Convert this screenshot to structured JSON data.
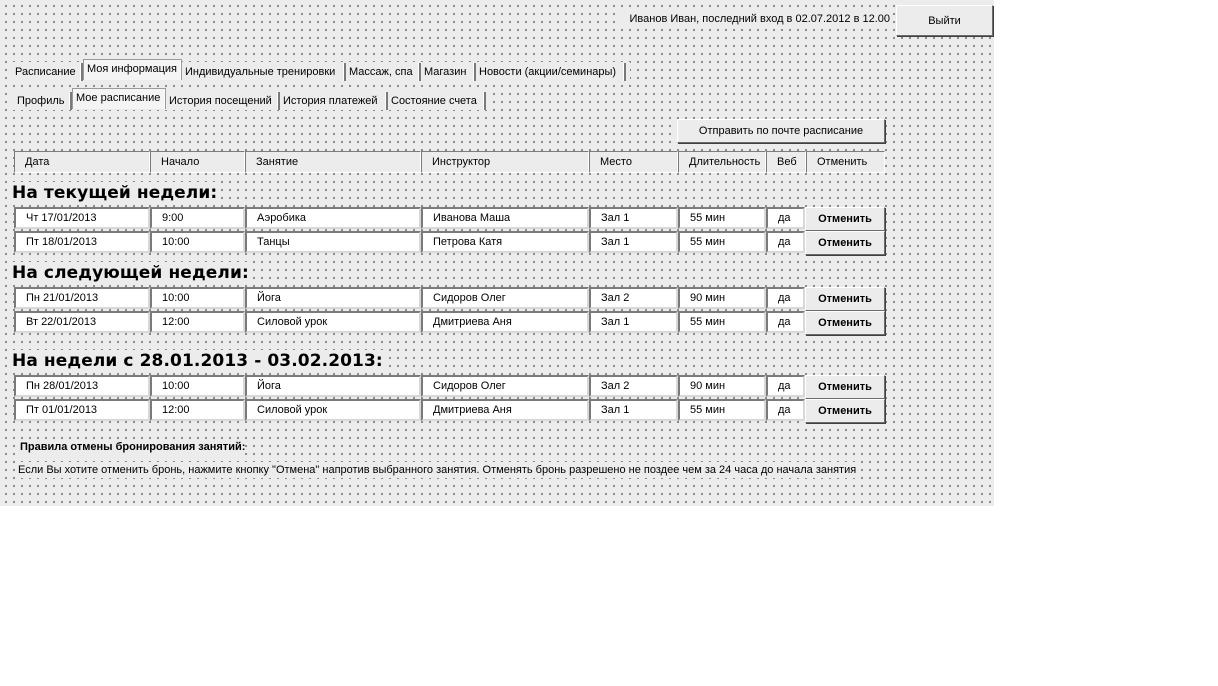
{
  "header": {
    "user_info": "Иванов Иван, последний вход в 02.07.2012 в 12.00",
    "logout_label": "Выйти"
  },
  "main_tabs": [
    {
      "label": "Расписание",
      "active": false
    },
    {
      "label": "Моя информация",
      "active": true
    },
    {
      "label": "Индивидуальные тренировки",
      "active": false
    },
    {
      "label": "Массаж, спа",
      "active": false
    },
    {
      "label": "Магазин",
      "active": false
    },
    {
      "label": "Новости (акции/семинары)",
      "active": false
    }
  ],
  "sub_tabs": [
    {
      "label": "Профиль",
      "active": false
    },
    {
      "label": "Мое расписание",
      "active": true
    },
    {
      "label": "История посещений",
      "active": false
    },
    {
      "label": "История платежей",
      "active": false
    },
    {
      "label": "Состояние счета",
      "active": false
    }
  ],
  "send_schedule_label": "Отправить по почте расписание",
  "columns": [
    "Дата",
    "Начало",
    "Занятие",
    "Инструктор",
    "Место",
    "Длительность",
    "Веб",
    "Отменить"
  ],
  "sections": [
    {
      "title": "На текущей недели:",
      "rows": [
        {
          "date": "Чт 17/01/2013",
          "start": "9:00",
          "activity": "Аэробика",
          "instructor": "Иванова Маша",
          "place": "Зал 1",
          "duration": "55 мин",
          "web": "да",
          "cancel": "Отменить"
        },
        {
          "date": "Пт 18/01/2013",
          "start": "10:00",
          "activity": "Танцы",
          "instructor": "Петрова Катя",
          "place": "Зал 1",
          "duration": "55 мин",
          "web": "да",
          "cancel": "Отменить"
        }
      ]
    },
    {
      "title": "На следующей недели:",
      "rows": [
        {
          "date": "Пн 21/01/2013",
          "start": "10:00",
          "activity": "Йога",
          "instructor": "Сидоров Олег",
          "place": "Зал 2",
          "duration": "90 мин",
          "web": "да",
          "cancel": "Отменить"
        },
        {
          "date": "Вт 22/01/2013",
          "start": "12:00",
          "activity": "Силовой урок",
          "instructor": "Дмитриева Аня",
          "place": "Зал 1",
          "duration": "55 мин",
          "web": "да",
          "cancel": "Отменить"
        }
      ]
    },
    {
      "title": "На недели с 28.01.2013 - 03.02.2013:",
      "rows": [
        {
          "date": "Пн 28/01/2013",
          "start": "10:00",
          "activity": "Йога",
          "instructor": "Сидоров Олег",
          "place": "Зал 2",
          "duration": "90 мин",
          "web": "да",
          "cancel": "Отменить"
        },
        {
          "date": "Пт 01/01/2013",
          "start": "12:00",
          "activity": "Силовой урок",
          "instructor": "Дмитриева Аня",
          "place": "Зал 1",
          "duration": "55 мин",
          "web": "да",
          "cancel": "Отменить"
        }
      ]
    }
  ],
  "rules": {
    "title": "Правила отмены бронирования занятий:",
    "text": "Если Вы хотите отменить бронь, нажмите кнопку \"Отмена\" напротив выбранного занятия. Отменять бронь разрешено не поздее чем за 24 часа до начала занятия"
  }
}
